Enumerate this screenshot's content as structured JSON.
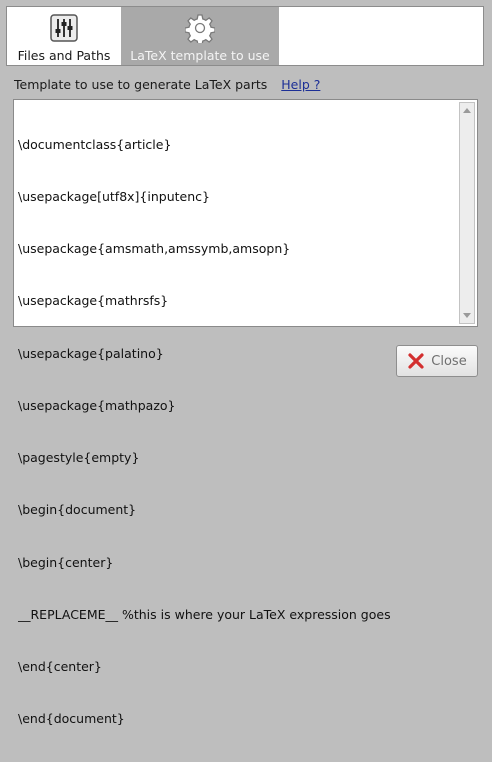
{
  "tabs": [
    {
      "label": "Files and Paths",
      "icon": "sliders-icon",
      "active": false
    },
    {
      "label": "LaTeX template to use",
      "icon": "gear-icon",
      "active": true
    }
  ],
  "section": {
    "heading": "Template to use to generate LaTeX parts",
    "help_link": "Help ?"
  },
  "template": {
    "lines": [
      "\\documentclass{article}",
      "\\usepackage[utf8x]{inputenc}",
      "\\usepackage{amsmath,amssymb,amsopn}",
      "\\usepackage{mathrsfs}",
      "\\usepackage{palatino}",
      "\\usepackage{mathpazo}",
      "\\pagestyle{empty}",
      "\\begin{document}",
      "\\begin{center}",
      "__REPLACEME__ %this is where your LaTeX expression goes",
      "\\end{center}",
      "\\end{document}"
    ]
  },
  "buttons": {
    "close_label": "Close",
    "close_icon": "close-icon"
  },
  "colors": {
    "window_bg": "#bebebe",
    "active_tab_bg": "#a9a9a9",
    "link": "#1c2f96",
    "close_icon": "#d32f2f"
  }
}
